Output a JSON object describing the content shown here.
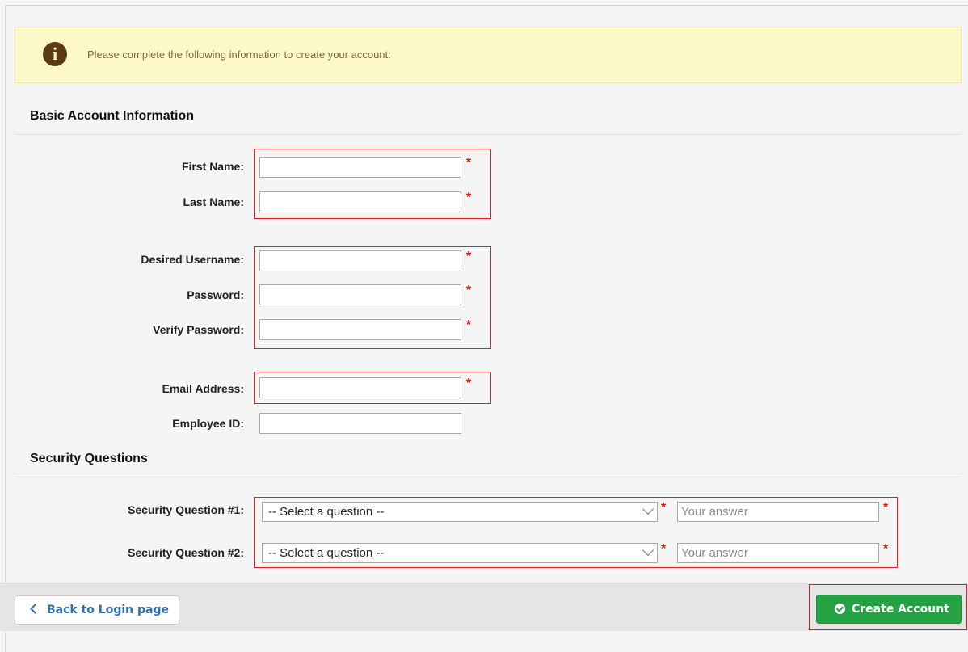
{
  "notice": {
    "icon": "info-icon",
    "icon_glyph": "i",
    "text": "Please complete the following information to create your account:"
  },
  "sections": {
    "basic": "Basic Account Information",
    "security": "Security Questions"
  },
  "fields": {
    "first_name": {
      "label": "First Name:",
      "value": ""
    },
    "last_name": {
      "label": "Last Name:",
      "value": ""
    },
    "username": {
      "label": "Desired Username:",
      "value": ""
    },
    "password": {
      "label": "Password:",
      "value": ""
    },
    "verify_password": {
      "label": "Verify Password:",
      "value": ""
    },
    "email": {
      "label": "Email Address:",
      "value": ""
    },
    "employee_id": {
      "label": "Employee ID:",
      "value": ""
    }
  },
  "required_marker": "*",
  "security_questions": [
    {
      "label": "Security Question #1:",
      "selected": "-- Select a question --",
      "answer_placeholder": "Your answer"
    },
    {
      "label": "Security Question #2:",
      "selected": "-- Select a question --",
      "answer_placeholder": "Your answer"
    }
  ],
  "footer": {
    "back_label": "Back to Login page",
    "create_label": "Create Account"
  },
  "colors": {
    "notice_bg": "#fcf8c7",
    "required": "#e01818",
    "highlight_box": "#e02020",
    "primary_button": "#25a244",
    "link": "#2d6fa8"
  }
}
